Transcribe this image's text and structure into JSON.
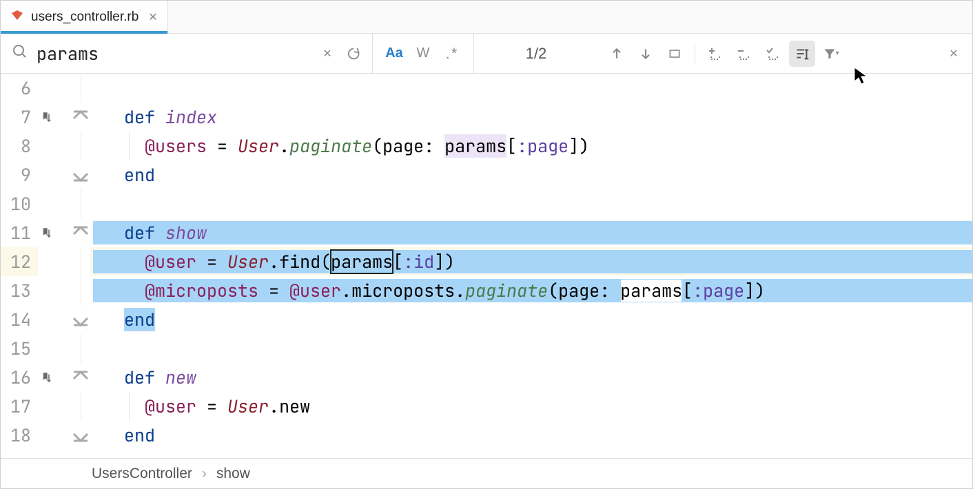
{
  "tab": {
    "filename": "users_controller.rb"
  },
  "search": {
    "query": "params",
    "count": "1/2",
    "aa": "Aa",
    "w": "W",
    "regex": ".*"
  },
  "gutter": [
    "6",
    "7",
    "8",
    "9",
    "10",
    "11",
    "12",
    "13",
    "14",
    "15",
    "16",
    "17",
    "18"
  ],
  "code": {
    "l7": {
      "def": "def ",
      "name": "index"
    },
    "l8": {
      "ivar": "@users",
      "eq": " = ",
      "const": "User",
      "dot": ".",
      "pg": "paginate",
      "open": "(page: ",
      "params": "params",
      "rest": "[",
      "sym": ":page",
      "close": "])"
    },
    "l9": {
      "end": "end"
    },
    "l11": {
      "def": "def ",
      "name": "show"
    },
    "l12": {
      "ivar": "@user",
      "eq": " = ",
      "const": "User",
      "dot": ".find(",
      "params": "params",
      "rest": "[",
      "sym": ":id",
      "close": "])"
    },
    "l13": {
      "ivar": "@microposts",
      "eq": " = ",
      "ivar2": "@user",
      "dot": ".microposts.",
      "pg": "paginate",
      "open": "(page: ",
      "params": "params",
      "rest": "[",
      "sym": ":page",
      "close": "])"
    },
    "l14": {
      "end": "end"
    },
    "l16": {
      "def": "def ",
      "name": "new"
    },
    "l17": {
      "ivar": "@user",
      "eq": " = ",
      "const": "User",
      "dot": ".new"
    },
    "l18": {
      "end": "end"
    }
  },
  "breadcrumb": {
    "a": "UsersController",
    "b": "show"
  }
}
